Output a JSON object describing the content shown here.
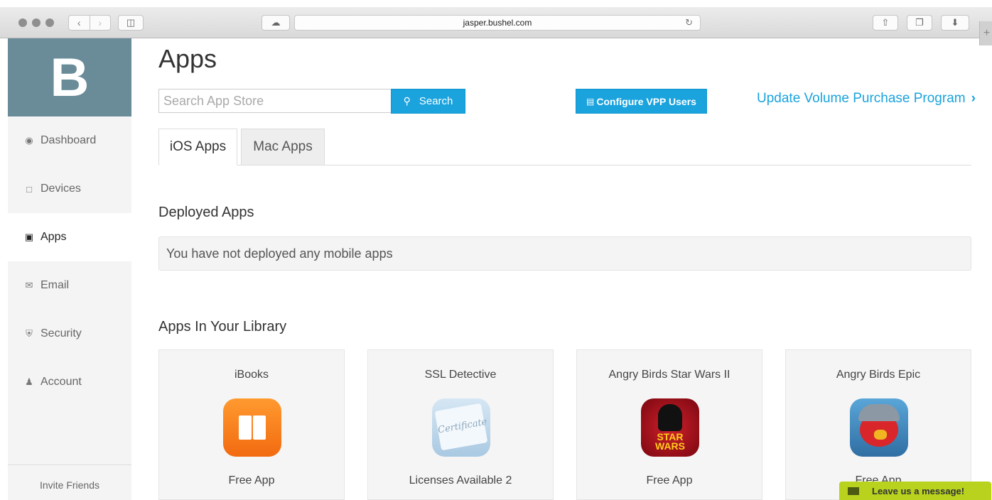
{
  "browser": {
    "url": "jasper.bushel.com",
    "icons": [
      "back-icon",
      "forward-icon",
      "sidebar-icon",
      "cloud-icon",
      "reload-icon",
      "share-icon",
      "tabs-icon",
      "download-icon",
      "new-tab-icon"
    ]
  },
  "sidebar": {
    "logo": "B",
    "items": [
      {
        "label": "Dashboard",
        "icon": "dashboard-icon"
      },
      {
        "label": "Devices",
        "icon": "device-icon"
      },
      {
        "label": "Apps",
        "icon": "puzzle-icon"
      },
      {
        "label": "Email",
        "icon": "envelope-icon"
      },
      {
        "label": "Security",
        "icon": "shield-icon"
      },
      {
        "label": "Account",
        "icon": "user-icon"
      }
    ],
    "active_item": "Apps",
    "invite": "Invite Friends"
  },
  "main": {
    "title": "Apps",
    "search": {
      "placeholder": "Search App Store",
      "button": "Search"
    },
    "vpp_button": "Configure VPP Users",
    "vpp_link": "Update Volume Purchase Program",
    "tabs": [
      {
        "label": "iOS Apps"
      },
      {
        "label": "Mac Apps"
      }
    ],
    "active_tab": "iOS Apps",
    "deployed": {
      "title": "Deployed Apps",
      "empty_message": "You have not deployed any mobile apps"
    },
    "library": {
      "title": "Apps In Your Library",
      "apps": [
        {
          "name": "iBooks",
          "status": "Free App",
          "icon": "ibooks-app-icon"
        },
        {
          "name": "SSL Detective",
          "status": "Licenses Available 2",
          "icon": "ssl-detective-app-icon",
          "icon_text": "Certificate"
        },
        {
          "name": "Angry Birds Star Wars II",
          "status": "Free App",
          "icon": "angry-birds-star-wars-app-icon",
          "icon_text": "STAR WARS"
        },
        {
          "name": "Angry Birds Epic",
          "status": "Free App",
          "icon": "angry-birds-epic-app-icon"
        }
      ]
    }
  },
  "chat_widget": {
    "label": "Leave us a message!"
  },
  "colors": {
    "accent": "#1aa3dd",
    "logo_bg": "#6a8c99",
    "chat_bg": "#b8d21e"
  }
}
